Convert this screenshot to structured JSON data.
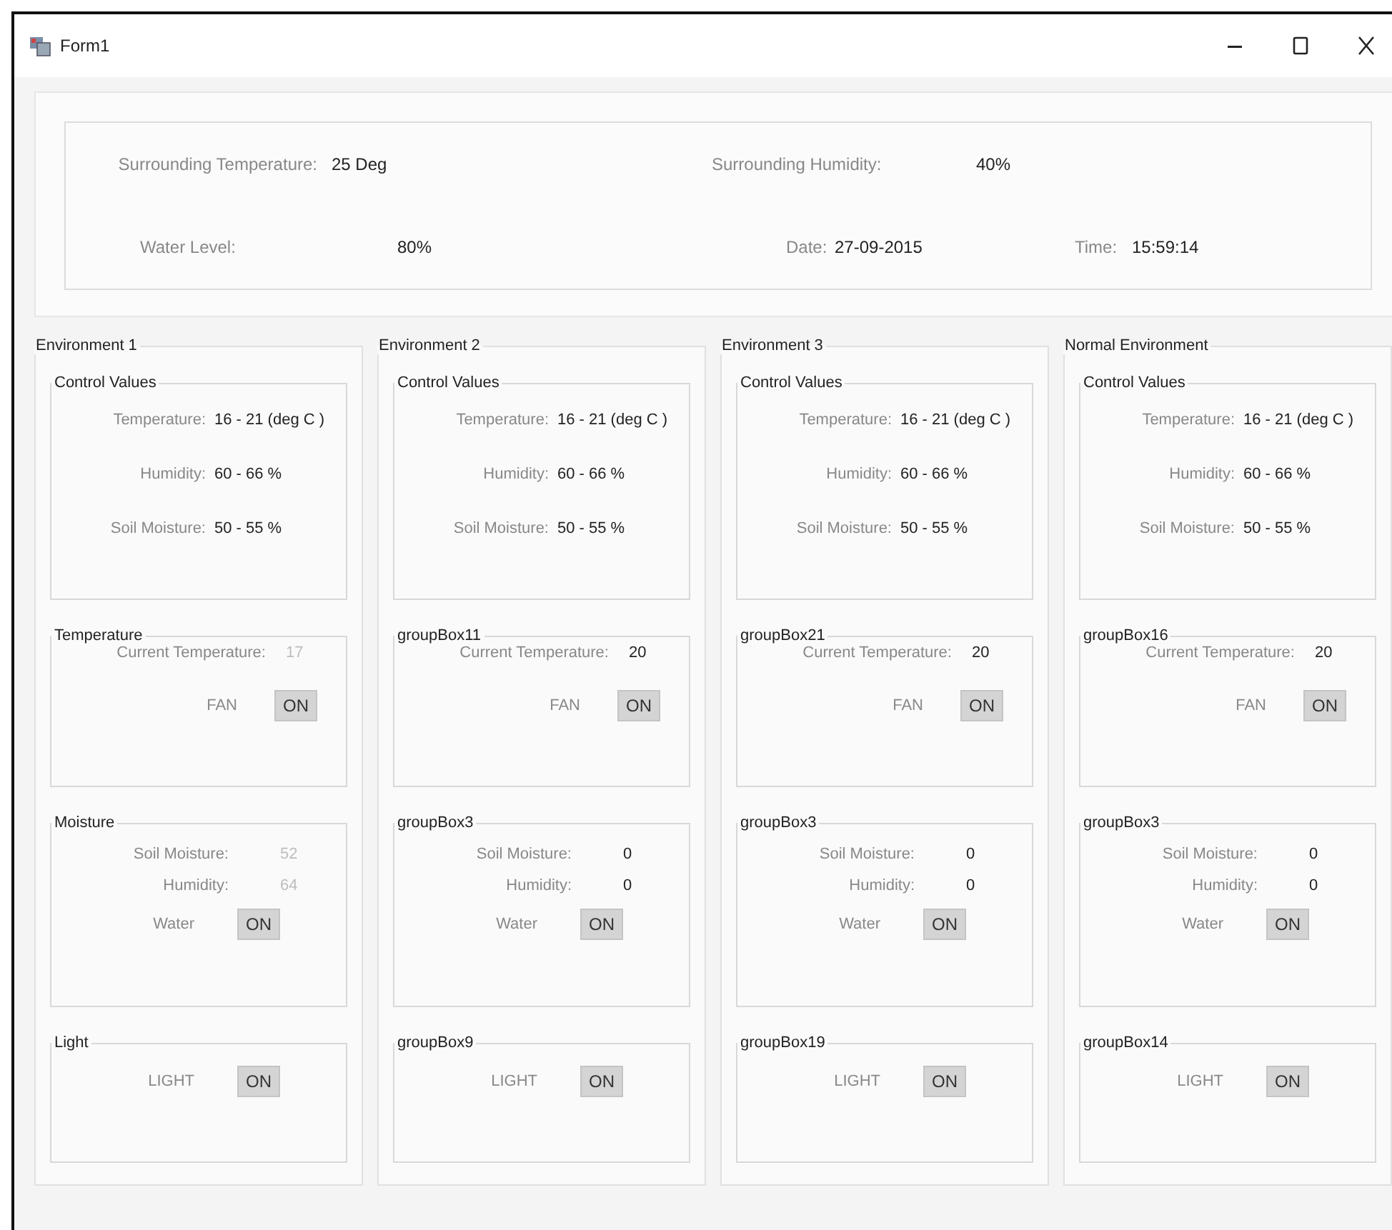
{
  "window": {
    "title": "Form1"
  },
  "summary": {
    "rows": [
      [
        {
          "label": "Surrounding Temperature:",
          "value": "25 Deg"
        },
        {
          "label": "Surrounding Humidity:",
          "value": "40%"
        }
      ],
      [
        {
          "label": "Water Level:",
          "value": "80%"
        },
        {
          "label": "Date:",
          "value": "27-09-2015"
        },
        {
          "label": "Time:",
          "value": "15:59:14"
        }
      ]
    ]
  },
  "environments": [
    {
      "title": "Environment 1",
      "groups": [
        {
          "kind": "range",
          "title": "Control Values",
          "disabled": false,
          "rows": [
            {
              "kind": "reading",
              "label": "Temperature:",
              "value": "16 - 21 (deg C )"
            },
            {
              "kind": "reading",
              "label": "Humidity:",
              "value": "60 - 66 %"
            },
            {
              "kind": "reading",
              "label": "Soil Moisture:",
              "value": "50 - 55 %"
            }
          ]
        },
        {
          "kind": "temperature",
          "title": "Temperature",
          "disabled": true,
          "rows": [
            {
              "kind": "reading",
              "label": "Current Temperature:",
              "value": "17"
            },
            {
              "kind": "switch",
              "label": "FAN",
              "button": "ON"
            }
          ]
        },
        {
          "kind": "moisture",
          "title": "Moisture",
          "disabled": true,
          "rows": [
            {
              "kind": "reading",
              "label": "Soil Moisture:",
              "value": "52"
            },
            {
              "kind": "reading",
              "label": "Humidity:",
              "value": "64"
            },
            {
              "kind": "switch",
              "label": "Water",
              "button": "ON"
            }
          ]
        },
        {
          "kind": "light",
          "title": "Light",
          "rows": [
            {
              "kind": "switch",
              "label": "LIGHT",
              "button": "ON"
            }
          ]
        }
      ]
    },
    {
      "title": "Environment 2",
      "groups": [
        {
          "kind": "range",
          "title": "Control Values",
          "disabled": false,
          "rows": [
            {
              "kind": "reading",
              "label": "Temperature:",
              "value": "16 - 21 (deg C )"
            },
            {
              "kind": "reading",
              "label": "Humidity:",
              "value": "60 - 66 %"
            },
            {
              "kind": "reading",
              "label": "Soil Moisture:",
              "value": "50 - 55 %"
            }
          ]
        },
        {
          "kind": "temperature",
          "title": "groupBox11",
          "disabled": false,
          "rows": [
            {
              "kind": "reading",
              "label": "Current Temperature:",
              "value": "20"
            },
            {
              "kind": "switch",
              "label": "FAN",
              "button": "ON"
            }
          ]
        },
        {
          "kind": "moisture",
          "title": "groupBox3",
          "disabled": false,
          "rows": [
            {
              "kind": "reading",
              "label": "Soil Moisture:",
              "value": "0"
            },
            {
              "kind": "reading",
              "label": "Humidity:",
              "value": "0"
            },
            {
              "kind": "switch",
              "label": "Water",
              "button": "ON"
            }
          ]
        },
        {
          "kind": "light",
          "title": "groupBox9",
          "rows": [
            {
              "kind": "switch",
              "label": "LIGHT",
              "button": "ON"
            }
          ]
        }
      ]
    },
    {
      "title": "Environment 3",
      "groups": [
        {
          "kind": "range",
          "title": "Control Values",
          "disabled": false,
          "rows": [
            {
              "kind": "reading",
              "label": "Temperature:",
              "value": "16 - 21 (deg C )"
            },
            {
              "kind": "reading",
              "label": "Humidity:",
              "value": "60 - 66 %"
            },
            {
              "kind": "reading",
              "label": "Soil Moisture:",
              "value": "50 - 55 %"
            }
          ]
        },
        {
          "kind": "temperature",
          "title": "groupBox21",
          "disabled": false,
          "rows": [
            {
              "kind": "reading",
              "label": "Current Temperature:",
              "value": "20"
            },
            {
              "kind": "switch",
              "label": "FAN",
              "button": "ON"
            }
          ]
        },
        {
          "kind": "moisture",
          "title": "groupBox3",
          "disabled": false,
          "rows": [
            {
              "kind": "reading",
              "label": "Soil Moisture:",
              "value": "0"
            },
            {
              "kind": "reading",
              "label": "Humidity:",
              "value": "0"
            },
            {
              "kind": "switch",
              "label": "Water",
              "button": "ON"
            }
          ]
        },
        {
          "kind": "light",
          "title": "groupBox19",
          "rows": [
            {
              "kind": "switch",
              "label": "LIGHT",
              "button": "ON"
            }
          ]
        }
      ]
    },
    {
      "title": "Normal Environment",
      "groups": [
        {
          "kind": "range",
          "title": "Control Values",
          "disabled": false,
          "rows": [
            {
              "kind": "reading",
              "label": "Temperature:",
              "value": "16 - 21 (deg C )"
            },
            {
              "kind": "reading",
              "label": "Humidity:",
              "value": "60 - 66 %"
            },
            {
              "kind": "reading",
              "label": "Soil Moisture:",
              "value": "50 - 55 %"
            }
          ]
        },
        {
          "kind": "temperature",
          "title": "groupBox16",
          "disabled": false,
          "rows": [
            {
              "kind": "reading",
              "label": "Current Temperature:",
              "value": "20"
            },
            {
              "kind": "switch",
              "label": "FAN",
              "button": "ON"
            }
          ]
        },
        {
          "kind": "moisture",
          "title": "groupBox3",
          "disabled": false,
          "rows": [
            {
              "kind": "reading",
              "label": "Soil Moisture:",
              "value": "0"
            },
            {
              "kind": "reading",
              "label": "Humidity:",
              "value": "0"
            },
            {
              "kind": "switch",
              "label": "Water",
              "button": "ON"
            }
          ]
        },
        {
          "kind": "light",
          "title": "groupBox14",
          "rows": [
            {
              "kind": "switch",
              "label": "LIGHT",
              "button": "ON"
            }
          ]
        }
      ]
    }
  ]
}
